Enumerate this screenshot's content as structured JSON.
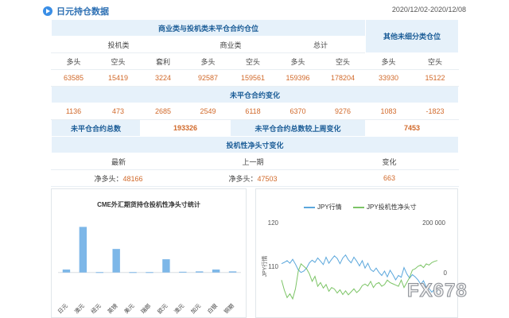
{
  "header": {
    "title": "日元持仓数据",
    "date_range": "2020/12/02-2020/12/08"
  },
  "table": {
    "section_reportable": "商业类与投机类未平仓合约仓位",
    "section_nonreportable": "其他未细分类仓位",
    "group_noncommercial": "投机类",
    "group_commercial": "商业类",
    "group_total": "总计",
    "col_long": "多头",
    "col_short": "空头",
    "col_spread": "套利",
    "positions": [
      "63585",
      "15419",
      "3224",
      "92587",
      "159561",
      "159396",
      "178204",
      "33930",
      "15122"
    ],
    "section_changes": "未平仓合约变化",
    "changes": [
      "1136",
      "473",
      "2685",
      "2549",
      "6118",
      "6370",
      "9276",
      "1083",
      "-1823"
    ],
    "oi_total_label": "未平仓合约总数",
    "oi_total_value": "193326",
    "oi_change_label": "未平仓合约总数较上周变化",
    "oi_change_value": "7453",
    "section_net": "投机性净头寸变化",
    "net_latest_label": "最新",
    "net_prev_label": "上一期",
    "net_change_label": "变化",
    "net_prefix": "净多头：",
    "net_latest_value": "48166",
    "net_prev_value": "47503",
    "net_change_value": "663"
  },
  "colors": {
    "accent": "#3a8ee6",
    "section_bg": "#e6f1fa",
    "value_orange": "#d1692a",
    "bar_blue": "#7db7e8",
    "jpy_line": "#5ba7dc",
    "net_line": "#7cc466"
  },
  "icons": {
    "header": "circle-play-icon"
  },
  "chart_data": [
    {
      "type": "bar",
      "title": "CME外汇期货持仓投机性净头寸统计",
      "categories": [
        "日元",
        "澳元",
        "纽元",
        "英镑",
        "美元",
        "瑞郎",
        "欧元",
        "澳元",
        "加元",
        "白银",
        "铜期"
      ],
      "values": [
        4,
        62,
        0.5,
        32,
        0.5,
        0.5,
        18,
        1,
        1.5,
        4,
        1.5
      ],
      "ylim": [
        -10,
        70
      ],
      "grid": false
    },
    {
      "type": "line",
      "legend": [
        "JPY行情",
        "JPY投机性净头寸"
      ],
      "legend_position": "top",
      "left_axis": {
        "label": "JPY行情",
        "ticks": [
          "120",
          "110"
        ],
        "range": [
          100,
          120
        ]
      },
      "right_axis": {
        "ticks": [
          "200 000",
          "0"
        ],
        "range": [
          -150000,
          200000
        ]
      },
      "series": [
        {
          "name": "JPY行情",
          "axis": "left",
          "values": [
            110.6,
            110.9,
            111.3,
            110.7,
            111.6,
            110.5,
            109.2,
            108.6,
            108.9,
            109.6,
            110.8,
            111.4,
            110.9,
            111.9,
            111.2,
            110.4,
            112.1,
            110.7,
            111.6,
            112.4,
            111.8,
            110.6,
            111.9,
            112.6,
            111.5,
            110.8,
            112.1,
            111.2,
            110.1,
            111.3,
            109.6,
            110.7,
            109.3,
            108.8,
            109.6,
            108.6,
            107.9,
            108.9,
            107.6,
            109.1,
            108.1,
            106.9,
            107.9,
            107.5,
            109.7,
            108.3,
            107.3,
            108.1,
            107.6,
            106.9,
            105.9,
            106.7,
            105.2,
            104.9,
            104.1,
            104.8,
            104.2
          ]
        },
        {
          "name": "JPY投机性净头寸",
          "axis": "right",
          "values": [
            -30000,
            -70000,
            -100000,
            -85000,
            -105000,
            -65000,
            5000,
            35000,
            25000,
            15000,
            -5000,
            -35000,
            -15000,
            -55000,
            -40000,
            -62000,
            -48000,
            -75000,
            -60000,
            -66000,
            -82000,
            -69000,
            -88000,
            -73000,
            -89000,
            -77000,
            -65000,
            -80000,
            -70000,
            -52000,
            -46000,
            -54000,
            -35000,
            -60000,
            -45000,
            -40000,
            -55000,
            -48000,
            -30000,
            -40000,
            -45000,
            -50000,
            -55000,
            -30000,
            -60000,
            -40000,
            -20000,
            10000,
            15000,
            25000,
            30000,
            20000,
            35000,
            30000,
            40000,
            45000,
            48166
          ]
        }
      ]
    }
  ],
  "watermark": "FX678"
}
